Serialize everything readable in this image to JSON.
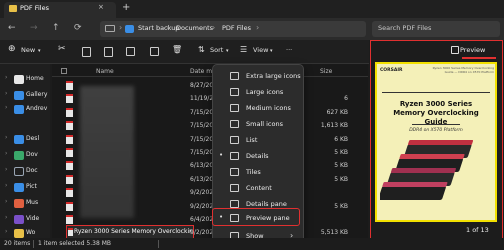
{
  "tab": {
    "title": "PDF Files",
    "close": "×",
    "new": "+"
  },
  "breadcrumb": [
    "Start backup",
    "Documents",
    "PDF Files"
  ],
  "breadcrumb_sep": "›",
  "search": {
    "placeholder": "Search PDF Files"
  },
  "toolbar": {
    "new": "New",
    "sort": "Sort",
    "view": "View",
    "more": "···",
    "preview": "Preview"
  },
  "sidebar": {
    "items": [
      {
        "label": "Home",
        "icon": "home-icon",
        "color": "#e8e8e8"
      },
      {
        "label": "Gallery",
        "icon": "gallery-icon",
        "color": "#3a8ee6"
      },
      {
        "label": "Andrev",
        "icon": "cloud-icon",
        "color": "#3a8ee6"
      },
      {
        "label": "Desl",
        "icon": "desktop-icon",
        "color": "#3a8ee6"
      },
      {
        "label": "Dov",
        "icon": "download-icon",
        "color": "#3aa86a"
      },
      {
        "label": "Doc",
        "icon": "documents-icon",
        "color": "#9aa6b4"
      },
      {
        "label": "Pict",
        "icon": "pictures-icon",
        "color": "#3a8ee6"
      },
      {
        "label": "Mus",
        "icon": "music-icon",
        "color": "#e06040"
      },
      {
        "label": "Vide",
        "icon": "videos-icon",
        "color": "#7a50c8"
      },
      {
        "label": "Wo",
        "icon": "folder-icon",
        "color": "#e8c048"
      }
    ]
  },
  "columns": {
    "name": "Name",
    "date": "Date mod",
    "size": "Size"
  },
  "files": [
    {
      "date": "8/27/2024",
      "size": ""
    },
    {
      "date": "11/19/20",
      "size": "6"
    },
    {
      "date": "7/15/202",
      "size": "627 KB"
    },
    {
      "date": "7/15/202",
      "size": "1,613 KB"
    },
    {
      "date": "7/15/202",
      "size": "6 KB"
    },
    {
      "date": "7/15/202",
      "size": "5 KB"
    },
    {
      "date": "6/13/202",
      "size": "5 KB"
    },
    {
      "date": "6/13/202",
      "size": "5 KB"
    },
    {
      "date": "9/2/202",
      "size": ""
    },
    {
      "date": "9/2/202",
      "size": "5 KB"
    },
    {
      "date": "6/4/202",
      "size": ""
    }
  ],
  "selected_file": {
    "name": "Ryzen 3000 Series Memory Overclocking Guide",
    "date": "9/2/202",
    "size": "5,513 KB"
  },
  "view_menu": {
    "items": [
      {
        "label": "Extra large icons",
        "dot": ""
      },
      {
        "label": "Large icons",
        "dot": ""
      },
      {
        "label": "Medium icons",
        "dot": ""
      },
      {
        "label": "Small icons",
        "dot": ""
      },
      {
        "label": "List",
        "dot": ""
      },
      {
        "label": "Details",
        "dot": "•"
      },
      {
        "label": "Tiles",
        "dot": ""
      },
      {
        "label": "Content",
        "dot": ""
      },
      {
        "label": "Details pane",
        "dot": ""
      },
      {
        "label": "Preview pane",
        "dot": "•"
      },
      {
        "label": "Show",
        "dot": ""
      }
    ],
    "show_arrow": "›"
  },
  "preview": {
    "logo": "CORSAIR",
    "header_note": "Ryzen 3000 Series Memory Overclocking Guide — DDR4 on X570 Platform",
    "title": "Ryzen 3000 Series Memory Overclocking Guide",
    "subtitle": "DDR4 on X570 Platform",
    "page_count": "1 of 13"
  },
  "status": {
    "items": "20 items",
    "selected": "1 item selected  5.38 MB"
  },
  "accent": "#e03030"
}
